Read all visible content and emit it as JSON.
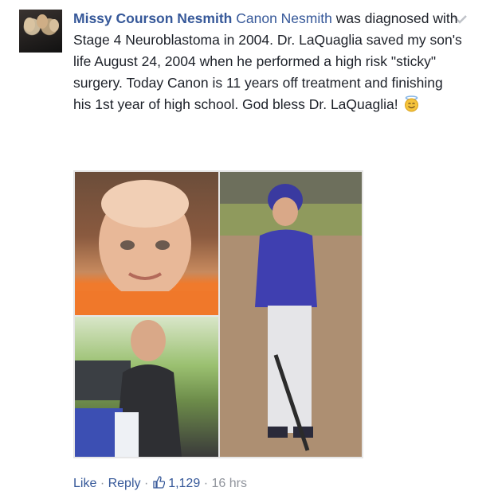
{
  "comment": {
    "author": "Missy Courson Nesmith",
    "tagged": "Canon Nesmith",
    "text": " was diagnosed with Stage 4 Neuroblastoma in 2004. Dr. LaQuaglia saved my son's life August 24, 2004 when he performed a high risk \"sticky\" surgery. Today Canon is 11 years off treatment and finishing his 1st year of high school. God bless Dr. LaQuaglia!",
    "emoji": "smiling-face-with-halo-icon"
  },
  "footer": {
    "like_label": "Like",
    "sep1": "·",
    "reply_label": "Reply",
    "sep2": "·",
    "like_count": "1,129",
    "sep3": "·",
    "time": "16 hrs"
  },
  "colors": {
    "link": "#365899",
    "text": "#1d2129",
    "meta": "#90949c"
  }
}
